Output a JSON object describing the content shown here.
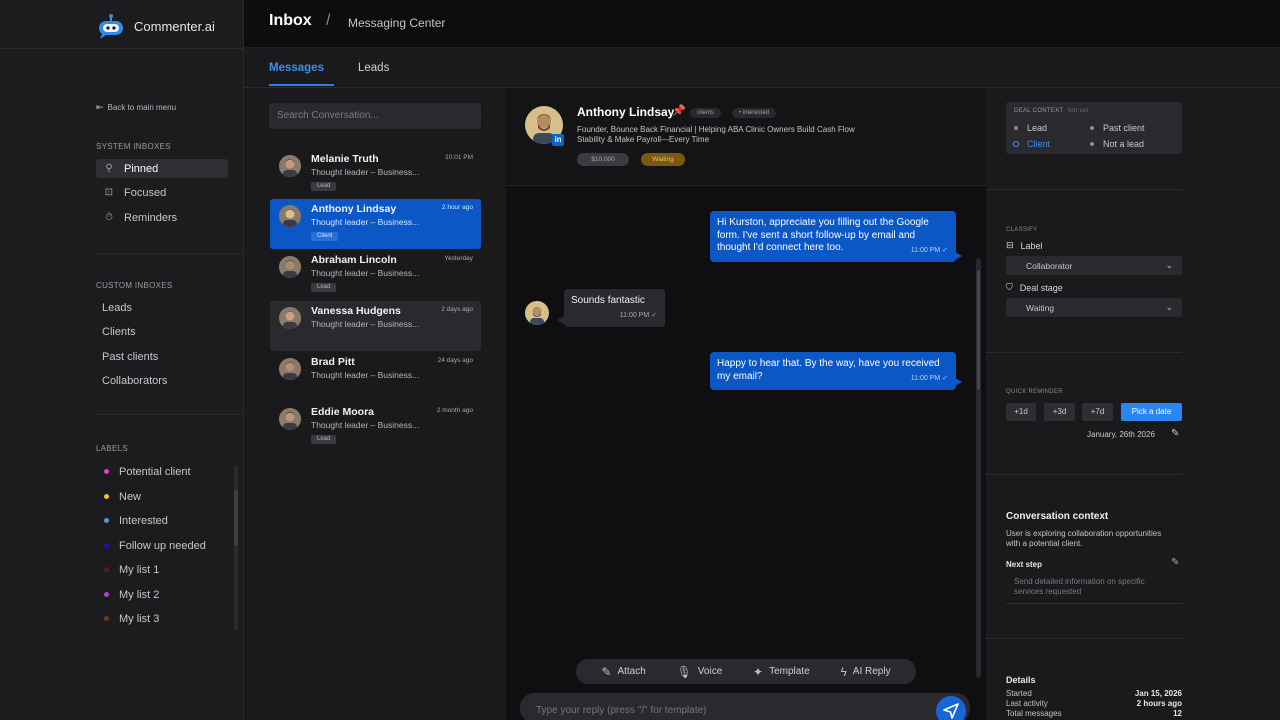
{
  "app": {
    "name": "Commenter.ai"
  },
  "breadcrumb": {
    "main": "Inbox",
    "separator": "/",
    "sub": "Messaging Center"
  },
  "tabs": [
    {
      "label": "Messages",
      "active": true
    },
    {
      "label": "Leads",
      "active": false
    }
  ],
  "sidebar": {
    "back_label": "Back to main menu",
    "system_title": "SYSTEM INBOXES",
    "system_items": [
      {
        "label": "Pinned",
        "icon": "pin-icon",
        "active": true
      },
      {
        "label": "Focused",
        "icon": "focus-icon"
      },
      {
        "label": "Reminders",
        "icon": "timer-icon"
      }
    ],
    "custom_title": "CUSTOM INBOXES",
    "custom_items": [
      {
        "label": "Leads"
      },
      {
        "label": "Clients"
      },
      {
        "label": "Past clients"
      },
      {
        "label": "Collaborators"
      }
    ],
    "labels_title": "LABELS",
    "labels": [
      {
        "label": "Potential client",
        "color": "#e03ad8"
      },
      {
        "label": "New",
        "color": "#f2c230"
      },
      {
        "label": "Interested",
        "color": "#5e8fe8"
      },
      {
        "label": "Follow up needed",
        "color": "#1a18b8"
      },
      {
        "label": "My list 1",
        "color": "#5a1a1a"
      },
      {
        "label": "My list 2",
        "color": "#b040d8"
      },
      {
        "label": "My list 3",
        "color": "#6a3a18"
      }
    ]
  },
  "search": {
    "placeholder": "Search Conversation..."
  },
  "conversations": [
    {
      "name": "Melanie Truth",
      "time": "10:01 PM",
      "preview": "Thought leader – Business...",
      "tag": "Lead"
    },
    {
      "name": "Anthony Lindsay",
      "time": "2 hour ago",
      "preview": "Thought leader – Business...",
      "tag": "Client"
    },
    {
      "name": "Abraham Lincoln",
      "time": "Yesterday",
      "preview": "Thought leader – Business...",
      "tag": "Lead"
    },
    {
      "name": "Vanessa Hudgens",
      "time": "2 days ago",
      "preview": "Thought leader – Business...",
      "tag": ""
    },
    {
      "name": "Brad Pitt",
      "time": "24 days ago",
      "preview": "Thought leader – Business...",
      "tag": ""
    },
    {
      "name": "Eddie Moora",
      "time": "2 month ago",
      "preview": "Thought leader – Business...",
      "tag": "Lead"
    }
  ],
  "chat": {
    "name": "Anthony Lindsay",
    "chips": [
      "clients",
      "• interested"
    ],
    "title": "Founder, Bounce Back Financial | Helping ABA Clinic Owners Build Cash Flow Stability & Make Payroll—Every Time",
    "amount": "$10,000",
    "status": "Waiting",
    "linkedin_badge": "in",
    "messages": [
      {
        "dir": "out",
        "text": "Hi Kurston, appreciate you filling out the Google form. I've sent a short follow-up by email and thought I'd connect here too.",
        "time": "11:00 PM ✓"
      },
      {
        "dir": "in",
        "text": "Sounds fantastic",
        "time": "11:00 PM ✓"
      },
      {
        "dir": "out",
        "text": "Happy to hear that. By the way, have you received my email?",
        "time": "11:00 PM ✓"
      }
    ],
    "toolbar": [
      {
        "label": "Attach",
        "icon": "paperclip-icon"
      },
      {
        "label": "Voice",
        "icon": "microphone-icon"
      },
      {
        "label": "Template",
        "icon": "sparkle-icon"
      },
      {
        "label": "AI Reply",
        "icon": "lightning-icon"
      }
    ],
    "reply_placeholder": "Type your reply (press \"/\" for template)"
  },
  "right": {
    "deal_title": "DEAL CONTEXT",
    "deal_note": "Not set",
    "deal_options": [
      {
        "label": "Lead",
        "selected": false
      },
      {
        "label": "Past client",
        "selected": false
      },
      {
        "label": "Client",
        "selected": true
      },
      {
        "label": "Not a lead",
        "selected": false
      }
    ],
    "classify_title": "CLASSIFY",
    "label_title": "Label",
    "label_value": "Collaborator",
    "deal_stage_title": "Deal stage",
    "deal_stage_value": "Waiting",
    "reminder_title": "QUICK REMINDER",
    "reminder_buttons": [
      "+1d",
      "+3d",
      "+7d"
    ],
    "pick_date": "Pick a date",
    "reminder_date": "January, 26th 2026",
    "context_title": "Conversation context",
    "context_body": "User is exploring collaboration opportunities with a potential client.",
    "next_step_title": "Next step",
    "next_step_placeholder": "Send detailed information on specific services requested",
    "details_title": "Details",
    "details": [
      {
        "key": "Started",
        "value": "Jan 15, 2026"
      },
      {
        "key": "Last activity",
        "value": "2 hours ago"
      },
      {
        "key": "Total messages",
        "value": "12"
      }
    ]
  }
}
